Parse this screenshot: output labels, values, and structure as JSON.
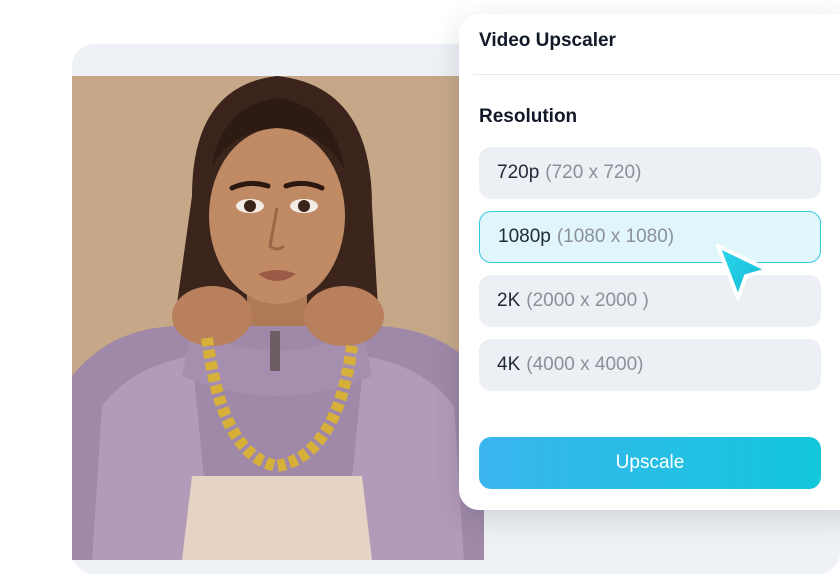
{
  "panel": {
    "title": "Video Upscaler",
    "section_label": "Resolution",
    "options": [
      {
        "name": "720p",
        "dims": "(720 x 720)",
        "selected": false
      },
      {
        "name": "1080p",
        "dims": "(1080 x 1080)",
        "selected": true
      },
      {
        "name": "2K",
        "dims": "(2000 x 2000 )",
        "selected": false
      },
      {
        "name": "4K",
        "dims": "(4000 x 4000)",
        "selected": false
      }
    ],
    "action_label": "Upscale"
  },
  "colors": {
    "accent": "#13c7dc",
    "selected_bg": "#e1f6fb",
    "option_bg": "#eceff3",
    "photo_bg": "#c6a888"
  },
  "icons": {
    "cursor": "pointer-arrow-icon"
  }
}
